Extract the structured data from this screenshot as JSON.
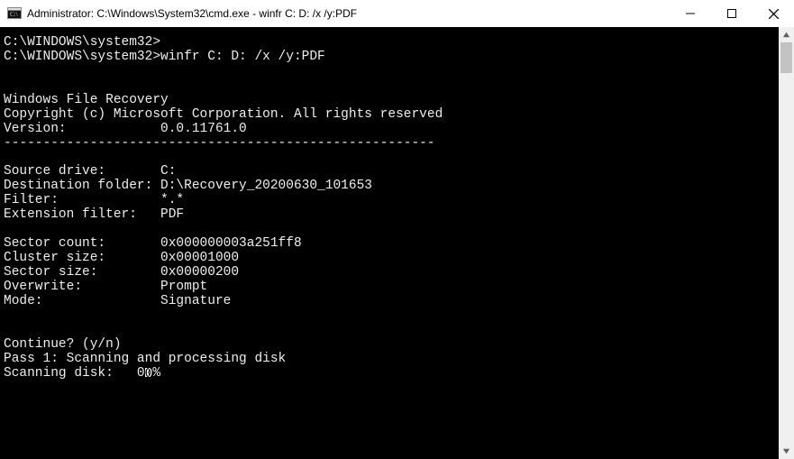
{
  "window": {
    "title": "Administrator: C:\\Windows\\System32\\cmd.exe - winfr  C: D: /x /y:PDF",
    "icon": "cmd-icon"
  },
  "terminal": {
    "prompt1": "C:\\WINDOWS\\system32>",
    "prompt2": "C:\\WINDOWS\\system32>",
    "command": "winfr C: D: /x /y:PDF",
    "blank1": "",
    "blank2": "",
    "app_name": "Windows File Recovery",
    "copyright": "Copyright (c) Microsoft Corporation. All rights reserved",
    "version_line": "Version:            0.0.11761.0",
    "divider": "-------------------------------------------------------",
    "blank3": "",
    "src_line": "Source drive:       C:",
    "dest_line": "Destination folder: D:\\Recovery_20200630_101653",
    "filter_line": "Filter:             *.*",
    "ext_line": "Extension filter:   PDF",
    "blank4": "",
    "sector_count": "Sector count:       0x000000003a251ff8",
    "cluster_size": "Cluster size:       0x00001000",
    "sector_size": "Sector size:        0x00000200",
    "overwrite": "Overwrite:          Prompt",
    "mode": "Mode:               Signature",
    "blank5": "",
    "blank6": "",
    "continue_line": "Continue? (y/n)",
    "pass_line": "Pass 1: Scanning and processing disk",
    "scan_prefix": "Scanning disk:   0",
    "scan_mid_digit": "0",
    "scan_suffix": "%"
  }
}
